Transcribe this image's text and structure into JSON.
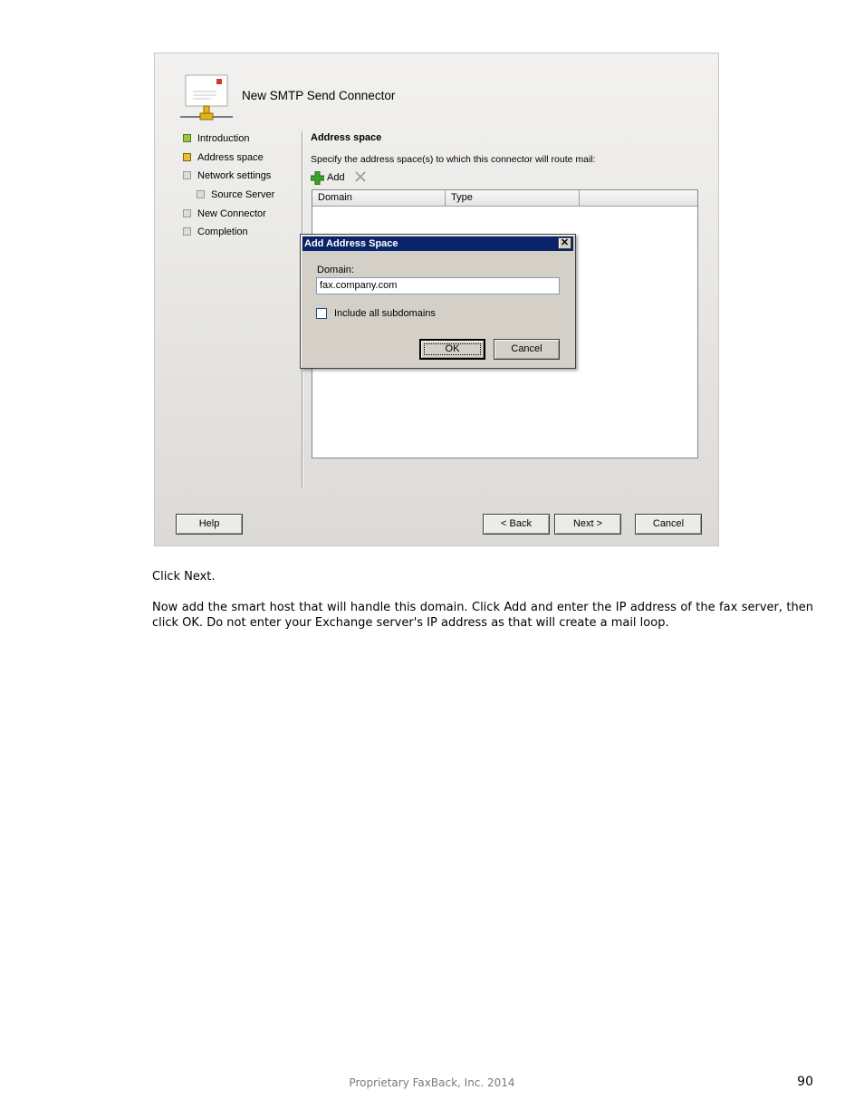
{
  "wizard": {
    "title": "New SMTP Send Connector",
    "nav_items": [
      {
        "label": "Introduction",
        "state": "done"
      },
      {
        "label": "Address space",
        "state": "current"
      },
      {
        "label": "Network settings",
        "state": "pending"
      },
      {
        "label": "Source Server",
        "state": "pending"
      },
      {
        "label": "New Connector",
        "state": "pending"
      },
      {
        "label": "Completion",
        "state": "pending"
      }
    ],
    "section_title": "Address space",
    "section_description": "Specify the address space(s) to which this connector will route mail:",
    "add_label": "Add",
    "columns": [
      "Domain",
      "Type",
      ""
    ],
    "buttons": {
      "help": "Help",
      "back": "< Back",
      "next": "Next >",
      "cancel": "Cancel"
    }
  },
  "dialog": {
    "title": "Add Address Space",
    "domain_label": "Domain:",
    "domain_value": "fax.company.com",
    "include_subdomains_label": "Include all subdomains",
    "include_subdomains_checked": false,
    "ok_label": "OK",
    "cancel_label": "Cancel"
  },
  "document": {
    "para1": "Click Next.",
    "para2": "Now add the smart host that will handle this domain. Click Add and enter the IP address of the fax server, then click OK. Do not enter your Exchange server's IP address as that will create a mail loop.",
    "footer": "Proprietary FaxBack, Inc. 2014",
    "page_number": "90"
  },
  "colors": {
    "nav_done": "#9ac43a",
    "nav_current": "#e8c12b",
    "dialog_title_bar": "#0a246a",
    "add_icon": "#3aa12a"
  }
}
